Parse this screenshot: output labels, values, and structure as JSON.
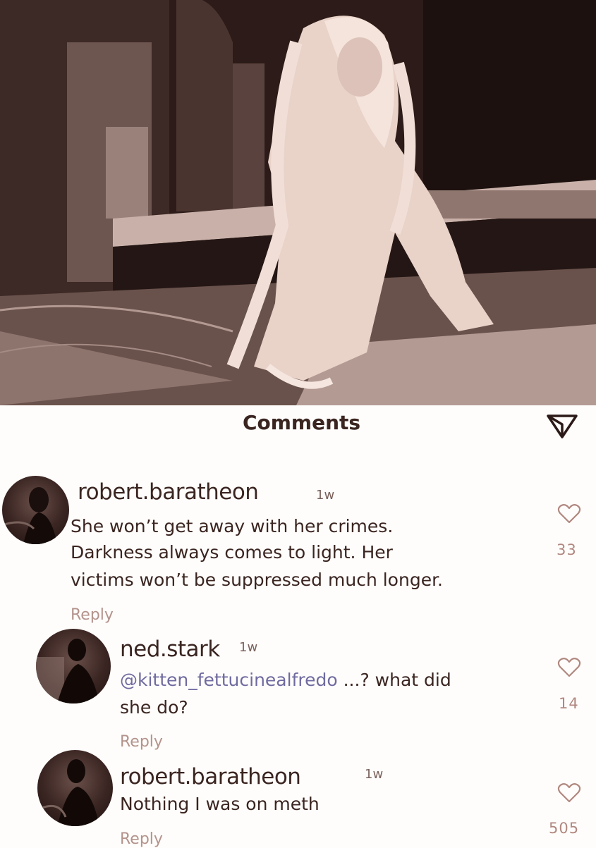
{
  "header": {
    "title": "Comments",
    "send_icon": "send-icon"
  },
  "comments": [
    {
      "username": "robert.baratheon",
      "time": "1w",
      "lines": [
        "She won’t get away with her crimes.",
        "Darkness always comes to light. Her",
        "victims won’t be suppressed much longer."
      ],
      "reply_label": "Reply",
      "likes": "33",
      "like_icon": "heart-icon"
    },
    {
      "username": "ned.stark",
      "time": "1w",
      "mention": "@kitten_fettucinealfredo",
      "line1_rest": " ...? what did",
      "line2": "she do?",
      "reply_label": "Reply",
      "likes": "14",
      "like_icon": "heart-icon"
    },
    {
      "username": "robert.baratheon",
      "time": "1w",
      "lines": [
        "Nothing I was on meth"
      ],
      "reply_label": "Reply",
      "likes": "505",
      "like_icon": "heart-icon"
    }
  ],
  "colors": {
    "sepia_dark": "#2a1a17",
    "sepia_light": "#f3dcd2",
    "mention": "#6f6ba0",
    "likes": "#b08880"
  }
}
